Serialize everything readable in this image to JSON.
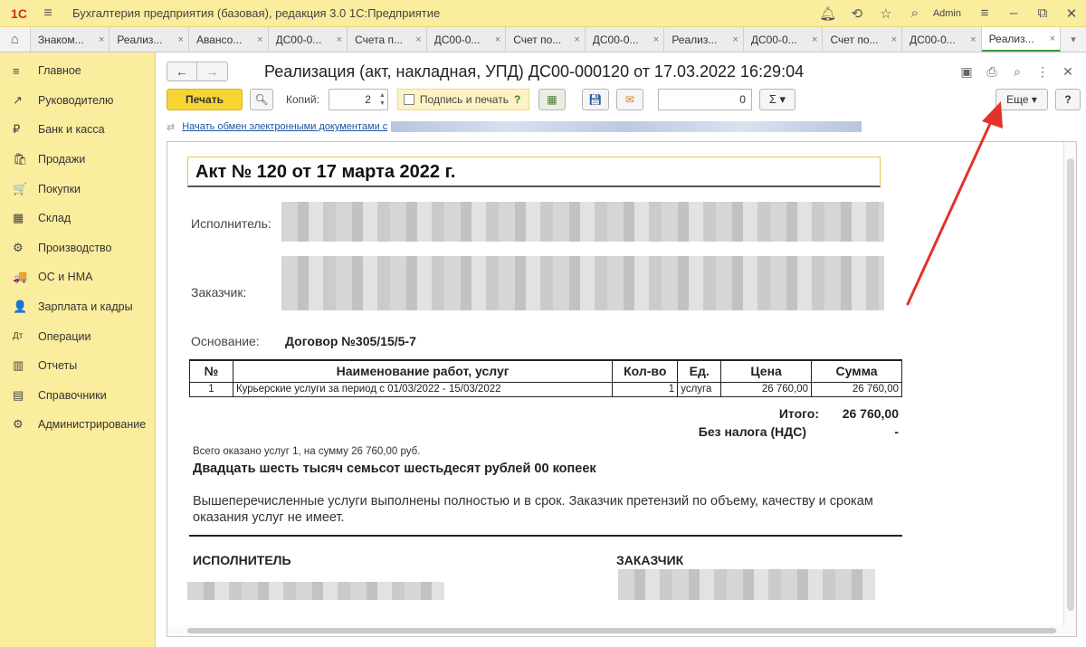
{
  "titlebar": {
    "logo": "1С",
    "title": "Бухгалтерия предприятия (базовая), редакция 3.0 1С:Предприятие",
    "user": "Admin"
  },
  "tabs": [
    {
      "label": "Знаком..."
    },
    {
      "label": "Реализ..."
    },
    {
      "label": "Авансо..."
    },
    {
      "label": "ДС00-0..."
    },
    {
      "label": "Счета п..."
    },
    {
      "label": "ДС00-0..."
    },
    {
      "label": "Счет по..."
    },
    {
      "label": "ДС00-0..."
    },
    {
      "label": "Реализ..."
    },
    {
      "label": "ДС00-0..."
    },
    {
      "label": "Счет по..."
    },
    {
      "label": "ДС00-0..."
    },
    {
      "label": "Реализ..."
    }
  ],
  "sidebar": {
    "items": [
      {
        "label": "Главное",
        "icon": "≡"
      },
      {
        "label": "Руководителю",
        "icon": "↗"
      },
      {
        "label": "Банк и касса",
        "icon": "₽"
      },
      {
        "label": "Продажи",
        "icon": "🛍"
      },
      {
        "label": "Покупки",
        "icon": "🛒"
      },
      {
        "label": "Склад",
        "icon": "▦"
      },
      {
        "label": "Производство",
        "icon": "⚙"
      },
      {
        "label": "ОС и НМА",
        "icon": "🚚"
      },
      {
        "label": "Зарплата и кадры",
        "icon": "👤"
      },
      {
        "label": "Операции",
        "icon": "Дт"
      },
      {
        "label": "Отчеты",
        "icon": "▥"
      },
      {
        "label": "Справочники",
        "icon": "▤"
      },
      {
        "label": "Администрирование",
        "icon": "⚙"
      }
    ]
  },
  "document": {
    "title": "Реализация (акт, накладная, УПД) ДС00-000120 от 17.03.2022 16:29:04"
  },
  "toolbar": {
    "print_label": "Печать",
    "copies_label": "Копий:",
    "copies_value": "2",
    "sign_print_label": "Подпись и печать",
    "sign_help": "?",
    "sum_value": "0",
    "sigma_label": "Σ ▾",
    "more_label": "Еще ▾",
    "help_label": "?"
  },
  "edo": {
    "link_text": "Начать обмен электронными документами с"
  },
  "act": {
    "title": "Акт № 120 от 17 марта 2022 г.",
    "executor_label": "Исполнитель:",
    "customer_label": "Заказчик:",
    "basis_label": "Основание:",
    "basis_value": "Договор №305/15/5-7",
    "table": {
      "headers": [
        "№",
        "Наименование работ, услуг",
        "Кол-во",
        "Ед.",
        "Цена",
        "Сумма"
      ],
      "rows": [
        [
          "1",
          "Курьерские услуги за период с 01/03/2022 - 15/03/2022",
          "1",
          "услуга",
          "26 760,00",
          "26 760,00"
        ]
      ]
    },
    "total_label": "Итого:",
    "total_value": "26 760,00",
    "vat_label": "Без налога (НДС)",
    "vat_value": "-",
    "summary_small": "Всего оказано услуг 1, на сумму 26 760,00 руб.",
    "summary_words": "Двадцать шесть тысяч семьсот шестьдесят рублей 00 копеек",
    "note": "Вышеперечисленные услуги выполнены полностью и в срок. Заказчик претензий по объему, качеству и срокам оказания услуг не имеет.",
    "executor_sign_label": "ИСПОЛНИТЕЛЬ",
    "customer_sign_label": "ЗАКАЗЧИК"
  },
  "colors": {
    "sidebar_bg": "#fbed9e",
    "print_button": "#f7d633",
    "arrow": "#e3322b",
    "link": "#1a56a0"
  }
}
